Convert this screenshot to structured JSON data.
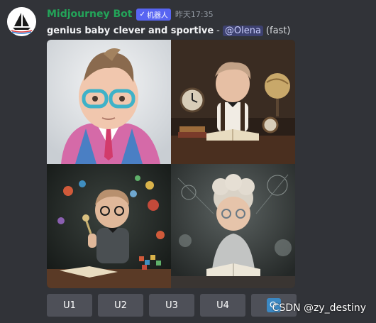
{
  "message": {
    "username": "Midjourney Bot",
    "bot_tag": "机器人",
    "timestamp": "昨天17:35",
    "prompt": "genius baby clever and sportive",
    "dash": "-",
    "mention": "@Olena",
    "speed": "(fast)"
  },
  "images": [
    {
      "name": "baby-glasses-pink-jacket"
    },
    {
      "name": "baby-desk-clock-globe"
    },
    {
      "name": "baby-chalkboard-balls"
    },
    {
      "name": "baby-hoodie-reading"
    }
  ],
  "buttons": {
    "u1": "U1",
    "u2": "U2",
    "u3": "U3",
    "u4": "U4"
  },
  "icons": {
    "refresh": "refresh-icon"
  },
  "watermark": "CSDN @zy_destiny"
}
